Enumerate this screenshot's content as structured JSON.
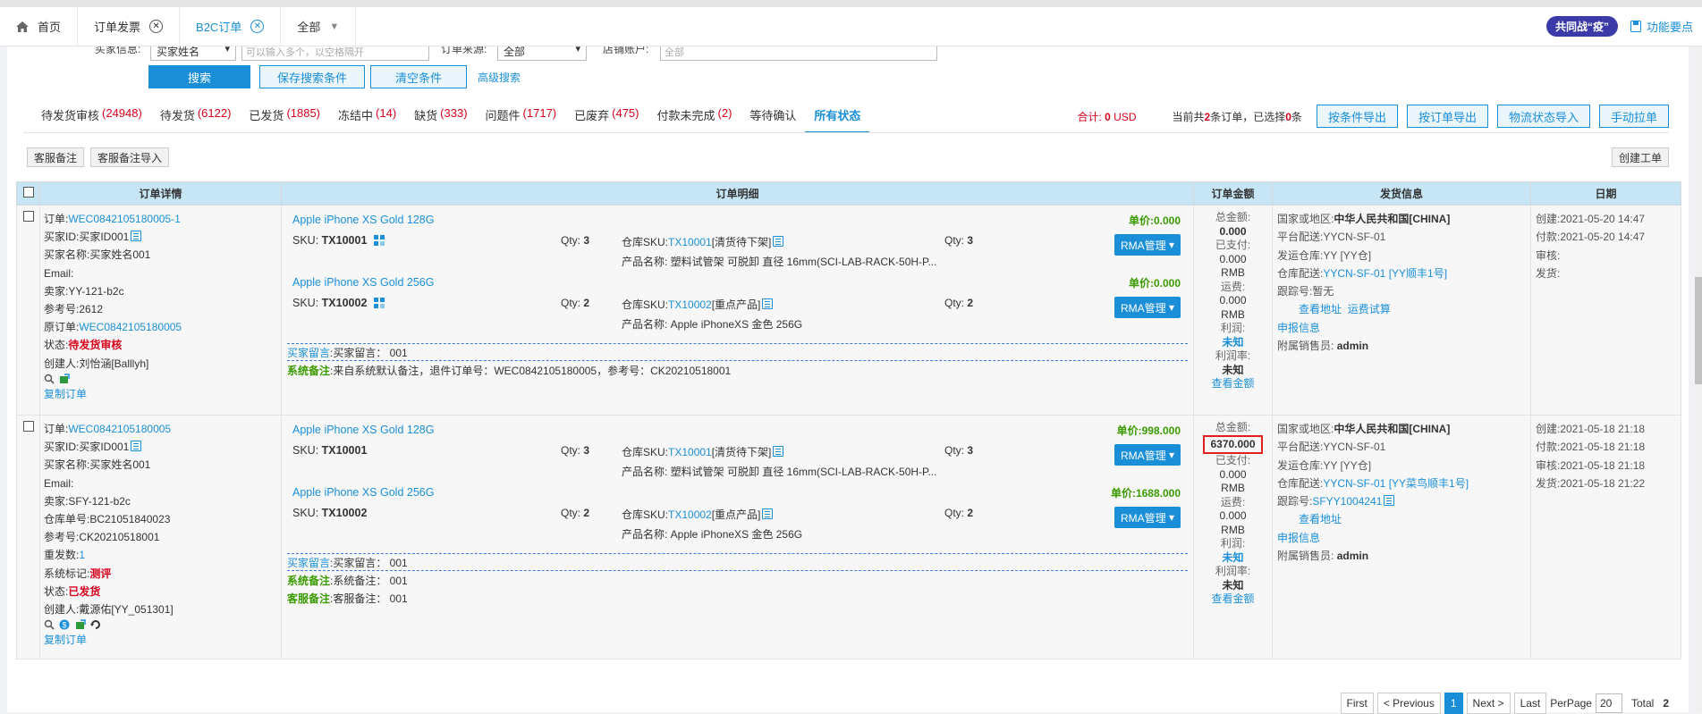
{
  "tabs": [
    {
      "label": "首页",
      "icon": "home-icon",
      "closable": false,
      "active": false
    },
    {
      "label": "订单发票",
      "closable": true,
      "active": false
    },
    {
      "label": "B2C订单",
      "closable": true,
      "active": true
    },
    {
      "label": "全部",
      "dropdown": true,
      "active": false
    }
  ],
  "topright": {
    "badge": "共同战“疫”",
    "function_link": "功能要点"
  },
  "search": {
    "buyer_info_label": "买家信息:",
    "buyer_field_select": "买家姓名",
    "buyer_input_placeholder": "可以输入多个，以空格隔开",
    "order_source_label": "订单来源:",
    "order_source_select": "全部",
    "store_account_label": "店铺账户:",
    "store_account_value": "全部",
    "search_button": "搜索",
    "save_button": "保存搜索条件",
    "clear_button": "清空条件",
    "advanced_link": "高级搜索"
  },
  "status_tabs": [
    {
      "label": "待发货审核",
      "count": "(24948)"
    },
    {
      "label": "待发货",
      "count": "(6122)"
    },
    {
      "label": "已发货",
      "count": "(1885)"
    },
    {
      "label": "冻结中",
      "count": "(14)"
    },
    {
      "label": "缺货",
      "count": "(333)"
    },
    {
      "label": "问题件",
      "count": "(1717)"
    },
    {
      "label": "已废弃",
      "count": "(475)"
    },
    {
      "label": "付款未完成",
      "count": "(2)"
    },
    {
      "label": "等待确认",
      "count": ""
    },
    {
      "label": "所有状态",
      "count": "",
      "active": true
    }
  ],
  "totals": {
    "total_label": "合计:",
    "total_value": "0",
    "currency": "USD",
    "summary_prefix": "当前共",
    "order_count": "2",
    "summary_mid": "条订单，已选择",
    "selected_count": "0",
    "summary_suffix": "条"
  },
  "toolbar": {
    "export_by_condition": "按条件导出",
    "export_by_order": "按订单导出",
    "import_logistics": "物流状态导入",
    "manual_pull": "手动拉单",
    "cs_note": "客服备注",
    "cs_note_import": "客服备注导入",
    "create_ticket": "创建工单"
  },
  "columns": [
    "订单详情",
    "订单明细",
    "订单金额",
    "发货信息",
    "日期"
  ],
  "orders": [
    {
      "detail": {
        "order_label": "订单:",
        "order_no": "WEC0842105180005-1",
        "buyer_id": "买家ID:买家ID001",
        "buyer_name": "买家名称:买家姓名001",
        "email": "Email:",
        "seller": "卖家:YY-121-b2c",
        "ref": "参考号:2612",
        "orig_label": "原订单:",
        "orig_no": "WEC0842105180005",
        "status_label": "状态:",
        "status": "待发货审核",
        "creator": "创建人:刘怡涵[Balllyh]",
        "copy": "复制订单"
      },
      "items": [
        {
          "name": "Apple iPhone XS Gold 128G",
          "sku_label": "SKU:",
          "sku": "TX10001",
          "qty": "3",
          "price_label": "单价:",
          "price": "0.000",
          "wh_label": "仓库SKU:",
          "wh_sku": "TX10001",
          "wh_tag": "[清货待下架]",
          "wh_qty": "3",
          "product": "产品名称: 塑料试管架 可脱卸 直径 16mm(SCI-LAB-RACK-50H-P...",
          "rma": "RMA管理"
        },
        {
          "name": "Apple iPhone XS Gold 256G",
          "sku_label": "SKU:",
          "sku": "TX10002",
          "qty": "2",
          "price_label": "单价:",
          "price": "0.000",
          "wh_label": "仓库SKU:",
          "wh_sku": "TX10002",
          "wh_tag": "[重点产品]",
          "wh_qty": "2",
          "product": "产品名称: Apple iPhoneXS 金色 256G",
          "rma": "RMA管理"
        }
      ],
      "notes": [
        {
          "key": "买家留言",
          "val": ":买家留言：  001",
          "style": "blue"
        },
        {
          "key": "系统备注",
          "val": ":来自系统默认备注，退件订单号：WEC0842105180005，参考号：CK20210518001",
          "style": "green"
        }
      ],
      "amount": {
        "total_label": "总金额:",
        "total": "0.000",
        "paid_label": "已支付:",
        "paid": "0.000",
        "paid_cur": "RMB",
        "freight_label": "运费:",
        "freight": "0.000",
        "freight_cur": "RMB",
        "profit_label": "利润:",
        "profit": "未知",
        "margin_label": "利润率:",
        "margin": "未知",
        "view": "查看金额"
      },
      "shipping": {
        "country_label": "国家或地区:",
        "country": "中华人民共和国[CHINA]",
        "platform": "平台配送:YYCN-SF-01",
        "warehouse": "发运仓库:YY [YY仓]",
        "wh_ship_label": "仓库配送:",
        "wh_ship": "YYCN-SF-01 [YY顺丰1号]",
        "tracking_label": "跟踪号:",
        "tracking": "暂无",
        "view_addr": "查看地址",
        "freight_calc": "运费试算",
        "declare": "申报信息",
        "sales_label": "附属销售员:",
        "sales": "admin"
      },
      "dates": [
        "创建:2021-05-20 14:47",
        "付款:2021-05-20 14:47",
        "审核:",
        "发货:"
      ]
    },
    {
      "detail": {
        "order_label": "订单:",
        "order_no": "WEC0842105180005",
        "buyer_id": "买家ID:买家ID001",
        "buyer_name": "买家名称:买家姓名001",
        "email": "Email:",
        "seller": "卖家:SFY-121-b2c",
        "warehouse_no": "仓库单号:BC21051840023",
        "ref": "参考号:CK20210518001",
        "resend_label": "重发数:",
        "resend": "1",
        "sys_tag_label": "系统标记:",
        "sys_tag": "测评",
        "status_label": "状态:",
        "status": "已发货",
        "creator": "创建人:戴源佑[YY_051301]",
        "copy": "复制订单"
      },
      "items": [
        {
          "name": "Apple iPhone XS Gold 128G",
          "sku_label": "SKU:",
          "sku": "TX10001",
          "qty": "3",
          "price_label": "单价:",
          "price": "998.000",
          "wh_label": "仓库SKU:",
          "wh_sku": "TX10001",
          "wh_tag": "[清货待下架]",
          "wh_qty": "3",
          "product": "产品名称: 塑料试管架 可脱卸 直径 16mm(SCI-LAB-RACK-50H-P...",
          "rma": "RMA管理"
        },
        {
          "name": "Apple iPhone XS Gold 256G",
          "sku_label": "SKU:",
          "sku": "TX10002",
          "qty": "2",
          "price_label": "单价:",
          "price": "1688.000",
          "wh_label": "仓库SKU:",
          "wh_sku": "TX10002",
          "wh_tag": "[重点产品]",
          "wh_qty": "2",
          "product": "产品名称: Apple iPhoneXS 金色 256G",
          "rma": "RMA管理"
        }
      ],
      "notes": [
        {
          "key": "买家留言",
          "val": ":买家留言：  001",
          "style": "blue"
        },
        {
          "key": "系统备注",
          "val": ":系统备注：  001",
          "style": "green"
        },
        {
          "key": "客服备注",
          "val": ":客服备注：  001",
          "style": "green"
        }
      ],
      "amount": {
        "total_label": "总金额:",
        "total": "6370.000",
        "paid_label": "已支付:",
        "paid": "0.000",
        "paid_cur": "RMB",
        "freight_label": "运费:",
        "freight": "0.000",
        "freight_cur": "RMB",
        "profit_label": "利润:",
        "profit": "未知",
        "margin_label": "利润率:",
        "margin": "未知",
        "view": "查看金额"
      },
      "shipping": {
        "country_label": "国家或地区:",
        "country": "中华人民共和国[CHINA]",
        "platform": "平台配送:YYCN-SF-01",
        "warehouse": "发运仓库:YY [YY仓]",
        "wh_ship_label": "仓库配送:",
        "wh_ship": "YYCN-SF-01 [YY菜鸟顺丰1号]",
        "tracking_label": "跟踪号:",
        "tracking": "SFYY1004241",
        "view_addr": "查看地址",
        "declare": "申报信息",
        "sales_label": "附属销售员:",
        "sales": "admin"
      },
      "dates": [
        "创建:2021-05-18 21:18",
        "付款:2021-05-18 21:18",
        "审核:2021-05-18 21:18",
        "发货:2021-05-18 21:22"
      ]
    }
  ],
  "pager": {
    "first": "First",
    "prev": "< Previous",
    "current": "1",
    "next": "Next >",
    "last": "Last",
    "perpage_label": "PerPage",
    "perpage": "20",
    "total_label": "Total",
    "total": "2"
  },
  "colors": {
    "accent": "#1a8fd8",
    "red": "#d9001b",
    "green": "#3a9b00",
    "header_bg": "#c6e6f5"
  }
}
